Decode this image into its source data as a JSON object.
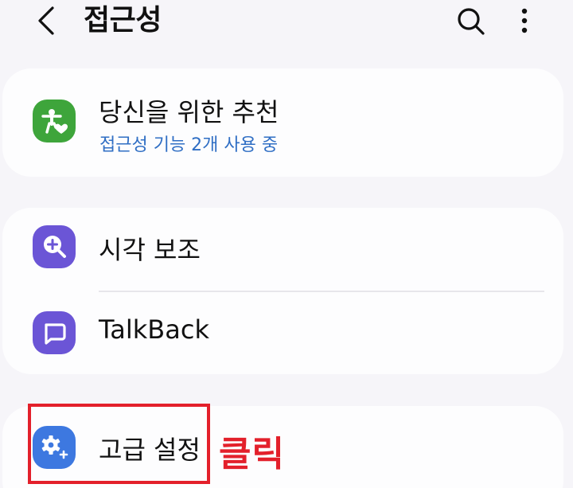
{
  "header": {
    "title": "접근성",
    "back_icon": "chevron-left-icon",
    "search_icon": "search-icon",
    "more_icon": "more-vertical-icon"
  },
  "cards": {
    "recommended": {
      "title": "당신을 위한 추천",
      "subtitle": "접근성 기능 2개 사용 중",
      "icon": "accessibility-person-heart-icon",
      "icon_color": "#3ea53b",
      "subtitle_color": "#2f6ec4"
    },
    "vision": {
      "title": "시각 보조",
      "icon": "magnifier-plus-icon",
      "icon_color": "#6b55d6"
    },
    "talkback": {
      "title": "TalkBack",
      "icon": "speech-bubble-icon",
      "icon_color": "#6b55d6"
    },
    "advanced": {
      "title": "고급 설정",
      "icon": "gear-plus-icon",
      "icon_color": "#3d78e0"
    }
  },
  "annotation": {
    "label": "클릭",
    "color": "#e3202b"
  },
  "colors": {
    "background": "#f6f5f9",
    "card": "#fdfdfe"
  }
}
